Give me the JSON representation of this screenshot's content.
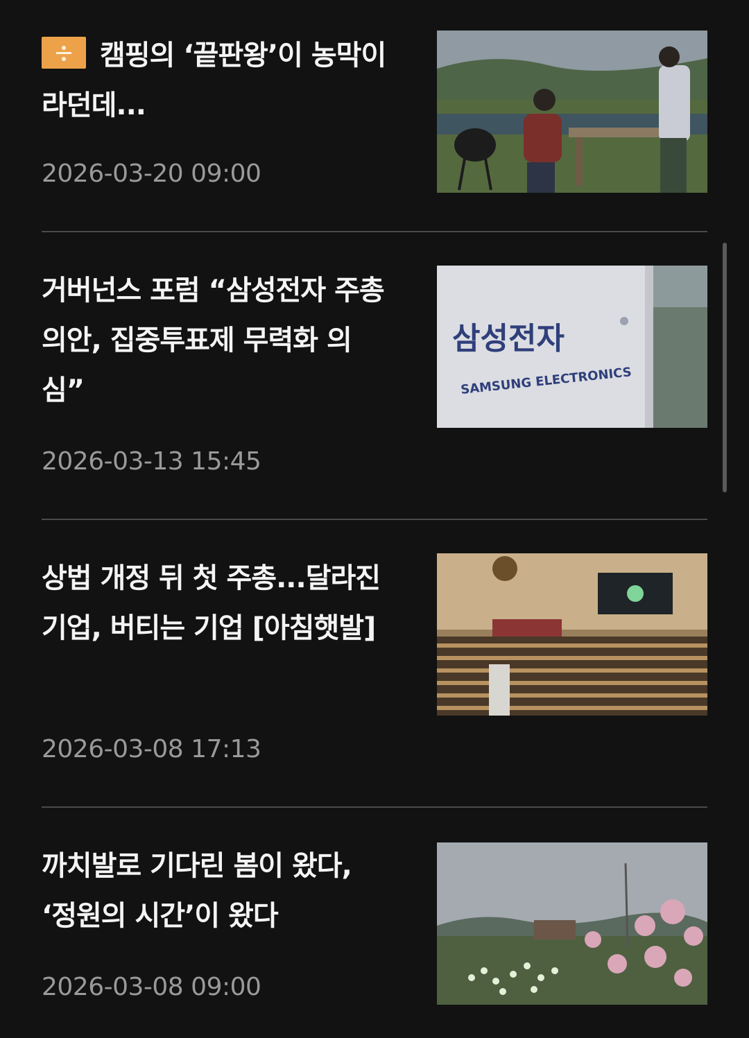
{
  "articles": [
    {
      "title": "캠핑의 ‘끝판왕’이 농막이라던데...",
      "date": "2026-03-20 09:00",
      "badge_icon": "divide-icon",
      "badge_color": "#eda24a",
      "thumbnail_alt": "campsite-photo"
    },
    {
      "title": "거버넌스 포럼 “삼성전자 주총 의안, 집중투표제 무력화 의심”",
      "date": "2026-03-13 15:45",
      "thumbnail_alt": "samsung-sign-photo",
      "thumbnail_text_ko": "삼성전자",
      "thumbnail_text_en": "SAMSUNG ELECTRONICS"
    },
    {
      "title": "상법 개정 뒤 첫 주총...달라진 기업, 버티는 기업 [아침햇발]",
      "date": "2026-03-08 17:13",
      "thumbnail_alt": "national-assembly-photo"
    },
    {
      "title": "까치발로 기다린 봄이 왔다, ‘정원의 시간’이 왔다",
      "date": "2026-03-08 09:00",
      "thumbnail_alt": "garden-flowers-photo"
    }
  ]
}
